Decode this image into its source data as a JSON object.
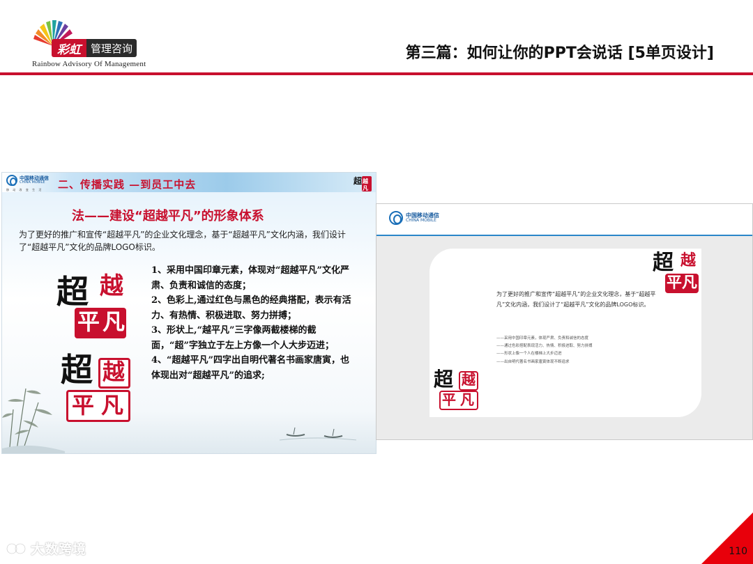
{
  "header": {
    "logo_brand": "彩虹",
    "logo_text": "管理咨询",
    "logo_subtitle": "Rainbow  Advisory  Of  Management",
    "title": "第三篇：如何让你的PPT会说话 [5单页设计]"
  },
  "colors": {
    "accent": "#c8102e",
    "corner_triangle": "#e8000b",
    "cmcc_blue": "#1a6fb8"
  },
  "left_slide": {
    "cmcc_name_cn": "中国移动通信",
    "cmcc_name_en": "CHINA MOBILE",
    "cmcc_tag": "移 动 改 变 生 活",
    "heading": "二、传播实践 —到员工中去",
    "title": "法——建设“超越平凡”的形象体系",
    "intro": "为了更好的推广和宣传“超越平凡”的企业文化理念，基于“超越平凡”文化内涵，我们设计了“超越平凡”文化的品牌LOGO标识。",
    "points": [
      "1、采用中国印章元素，体现对“超越平凡”文化严肃、负责和诚信的态度；",
      "2、色彩上,通过红色与黑色的经典搭配，表示有活力、有热情、积极进取、努力拼搏；",
      "3、形状上,“越平凡”三字像两截楼梯的截面，“超”字独立于左上方像一个人大步迈进；",
      "4、“超越平凡”四字出自明代著名书画家唐寅，也体现出对“超越平凡”的追求;"
    ],
    "seal_chars": [
      "超",
      "越",
      "平",
      "凡"
    ]
  },
  "right_slide": {
    "cmcc_name_cn": "中国移动通信",
    "cmcc_name_en": "CHINA MOBILE",
    "intro": "为了更好的推广和宣传“超越平凡”的企业文化理念，基于“超越平凡”文化内涵，我们设计了“超越平凡”文化的品牌LOGO标识。",
    "points": [
      "——采用中国印章元素，体现严肃、负责和诚信的态度",
      "——通过色彩搭配表现活力、热情、积极进取、努力拼搏",
      "——形状上像一个人在楼梯上大步迈进",
      "——出自明代著名书画家唐寅体现不断追求"
    ],
    "seal_chars": [
      "超",
      "越",
      "平",
      "凡"
    ]
  },
  "footer": {
    "watermark": "大数跨境",
    "page_number": "110"
  }
}
